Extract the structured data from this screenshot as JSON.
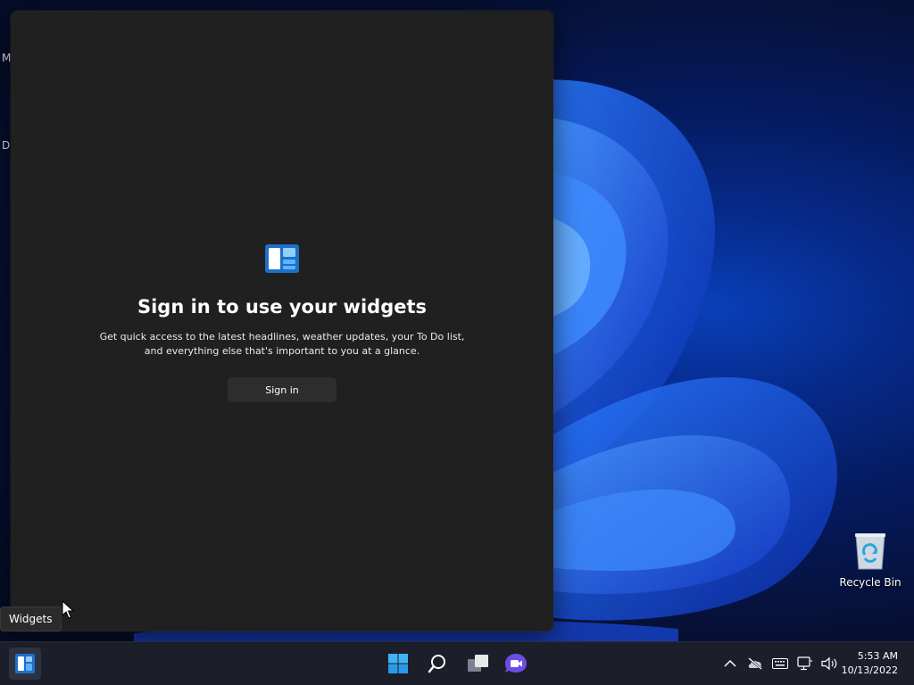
{
  "desktop": {
    "hint_letters": [
      "M",
      "D"
    ],
    "recycle_bin_label": "Recycle Bin"
  },
  "widgets_panel": {
    "title": "Sign in to use your widgets",
    "description": "Get quick access to the latest headlines, weather updates, your To Do list, and everything else that's important to you at a glance.",
    "signin_label": "Sign in"
  },
  "tooltip": {
    "text": "Widgets"
  },
  "taskbar": {
    "widgets_icon": "widgets-icon",
    "start_icon": "windows-start-icon",
    "search_icon": "search-icon",
    "taskview_icon": "task-view-icon",
    "chat_icon": "chat-icon",
    "tray_icons": [
      "chevron-up-icon",
      "cloud-offline-icon",
      "keyboard-icon",
      "network-icon",
      "volume-icon"
    ],
    "time": "5:53 AM",
    "date": "10/13/2022"
  },
  "colors": {
    "panel": "#202020",
    "accent": "#2f9ce8",
    "taskbar": "#1c1f2a"
  }
}
